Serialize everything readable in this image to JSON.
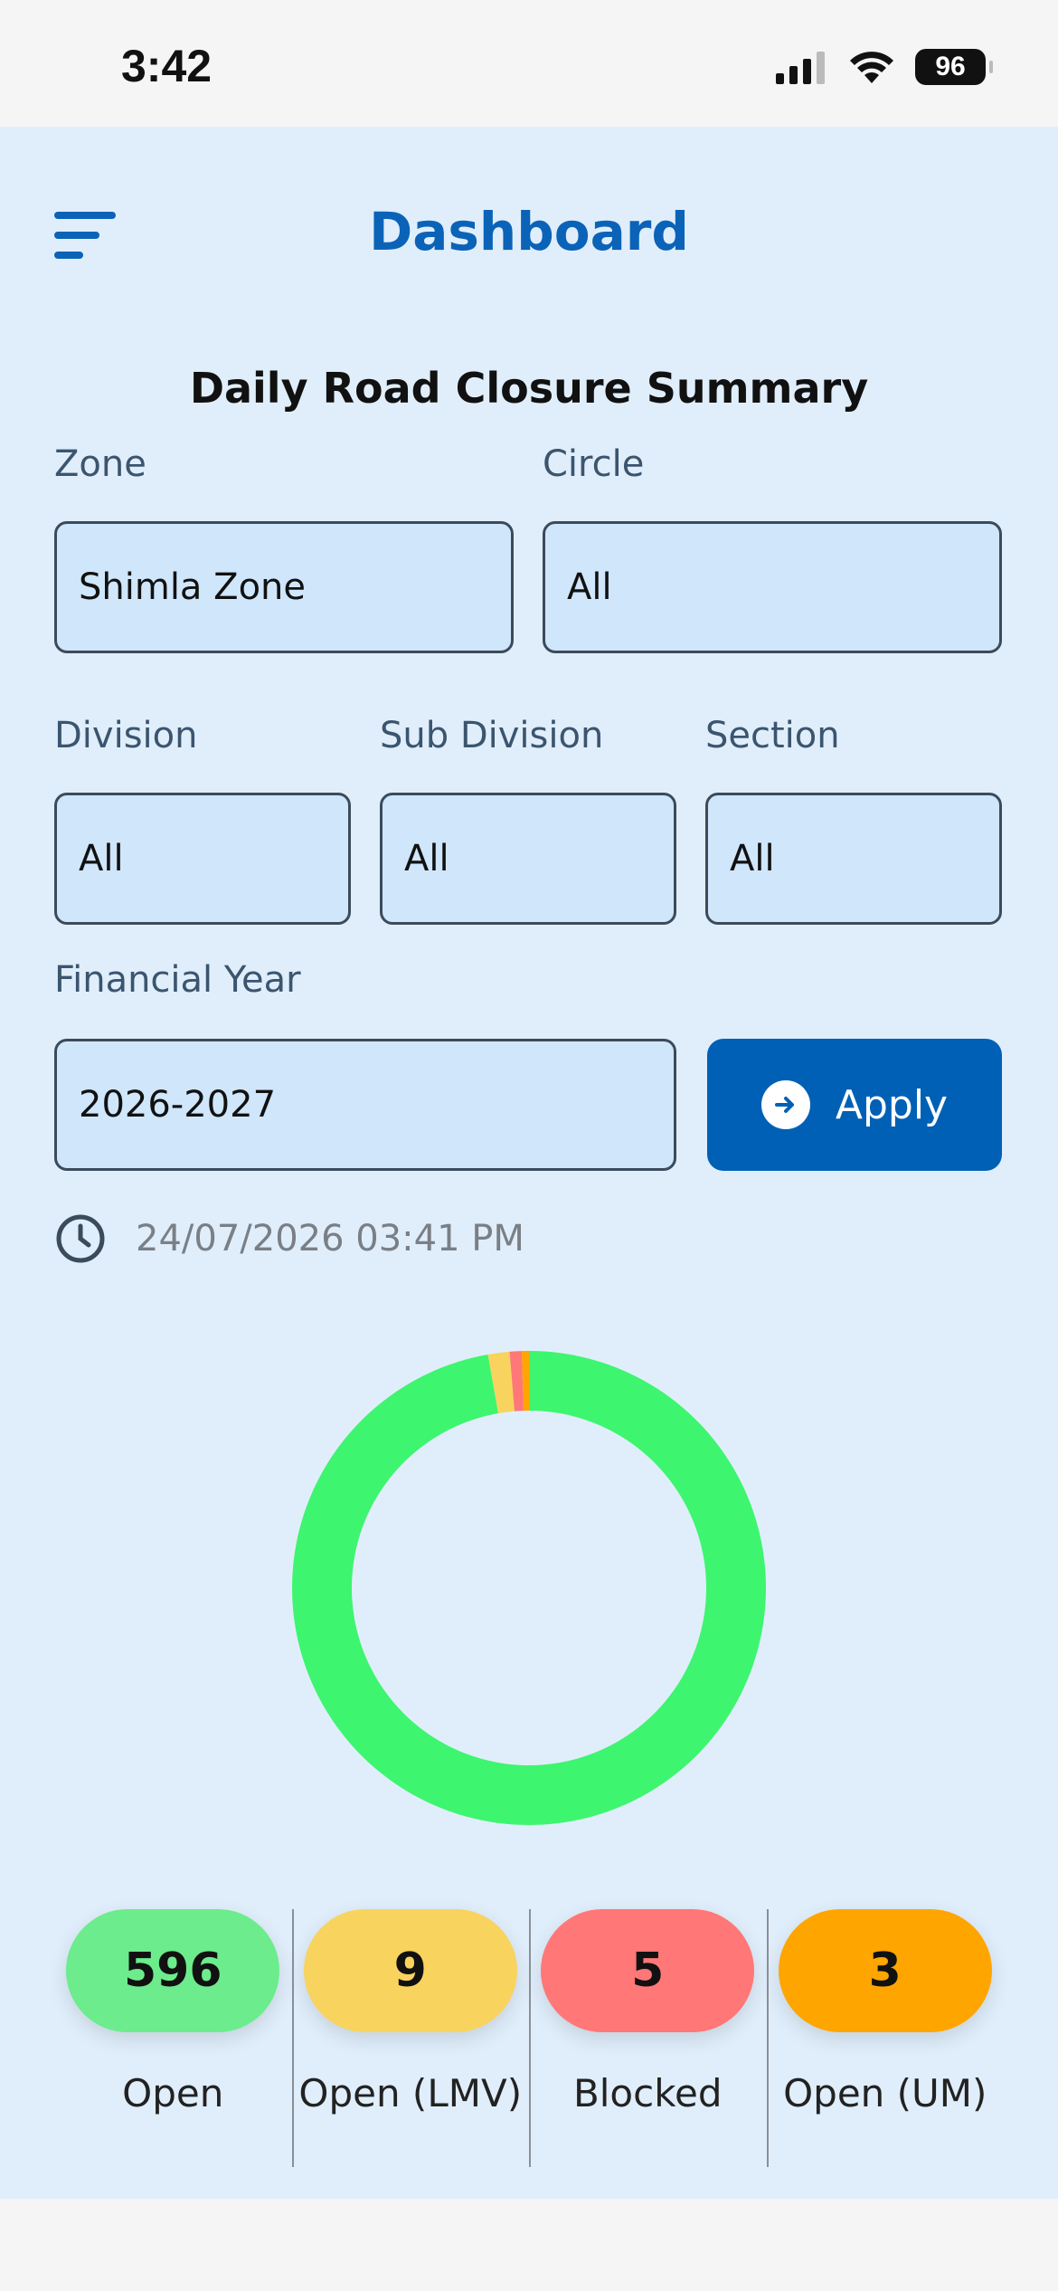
{
  "status_bar": {
    "time": "3:42",
    "battery": "96"
  },
  "header": {
    "title": "Dashboard"
  },
  "summary": {
    "title": "Daily Road Closure Summary",
    "filters": {
      "zone": {
        "label": "Zone",
        "value": "Shimla Zone"
      },
      "circle": {
        "label": "Circle",
        "value": "All"
      },
      "division": {
        "label": "Division",
        "value": "All"
      },
      "sub_division": {
        "label": "Sub Division",
        "value": "All"
      },
      "section": {
        "label": "Section",
        "value": "All"
      },
      "financial_year": {
        "label": "Financial Year",
        "value": "2026-2027"
      }
    },
    "apply_label": "Apply",
    "timestamp": "24/07/2026 03:41 PM"
  },
  "chart_data": {
    "type": "pie",
    "categories": [
      "Open",
      "Open (LMV)",
      "Blocked",
      "Open (UM)"
    ],
    "values": [
      596,
      9,
      5,
      3
    ],
    "colors": [
      "#3ef56f",
      "#f8d35e",
      "#ff7777",
      "#ffa500"
    ]
  },
  "stats": [
    {
      "value": "596",
      "label": "Open",
      "color": "#6cec8c"
    },
    {
      "value": "9",
      "label": "Open (LMV)",
      "color": "#f8d35e"
    },
    {
      "value": "5",
      "label": "Blocked",
      "color": "#ff7777"
    },
    {
      "value": "3",
      "label": "Open (UM)",
      "color": "#ffa500"
    }
  ]
}
